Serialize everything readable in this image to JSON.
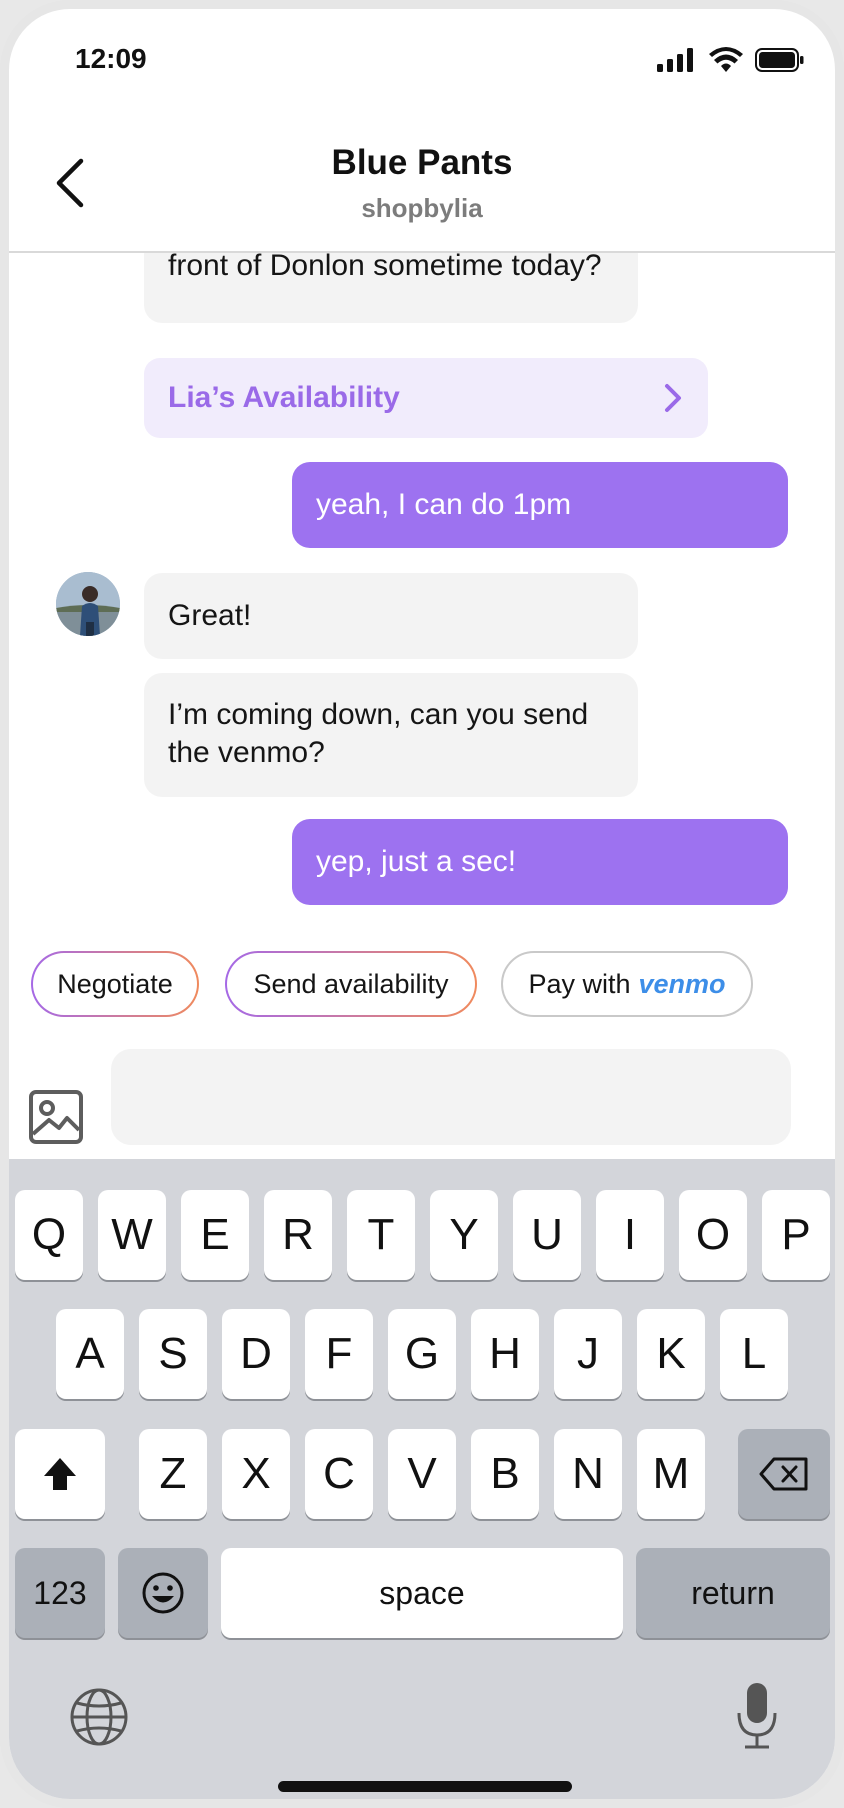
{
  "status_bar": {
    "time": "12:09",
    "icons": [
      "signal-icon",
      "wifi-icon",
      "battery-icon"
    ]
  },
  "header": {
    "title": "Blue Pants",
    "subtitle": "shopbylia",
    "back_icon": "chevron-left-icon"
  },
  "messages": [
    {
      "from": "seller",
      "text": "front of Donlon sometime today?"
    },
    {
      "from": "seller",
      "type": "card",
      "text": "Lia’s Availability"
    },
    {
      "from": "me",
      "text": "yeah, I can do 1pm"
    },
    {
      "from": "seller",
      "text": "Great!"
    },
    {
      "from": "seller",
      "text": "I’m coming down, can you send the venmo?"
    },
    {
      "from": "me",
      "text": "yep, just a sec!"
    }
  ],
  "quick_actions": {
    "negotiate": "Negotiate",
    "send_availability": "Send availability",
    "pay_prefix": "Pay with",
    "pay_brand": "venmo"
  },
  "composer": {
    "placeholder": "",
    "image_icon": "image-icon"
  },
  "keyboard": {
    "row1": [
      "Q",
      "W",
      "E",
      "R",
      "T",
      "Y",
      "U",
      "I",
      "O",
      "P"
    ],
    "row2": [
      "A",
      "S",
      "D",
      "F",
      "G",
      "H",
      "J",
      "K",
      "L"
    ],
    "row3": [
      "Z",
      "X",
      "C",
      "V",
      "B",
      "N",
      "M"
    ],
    "numbers": "123",
    "space": "space",
    "return": "return"
  },
  "colors": {
    "accent": "#9d72f0",
    "received_bubble": "#f3f3f3",
    "availability_bg": "#f1ecfc",
    "venmo": "#3d8ee8",
    "keyboard_bg": "#d3d5da"
  }
}
